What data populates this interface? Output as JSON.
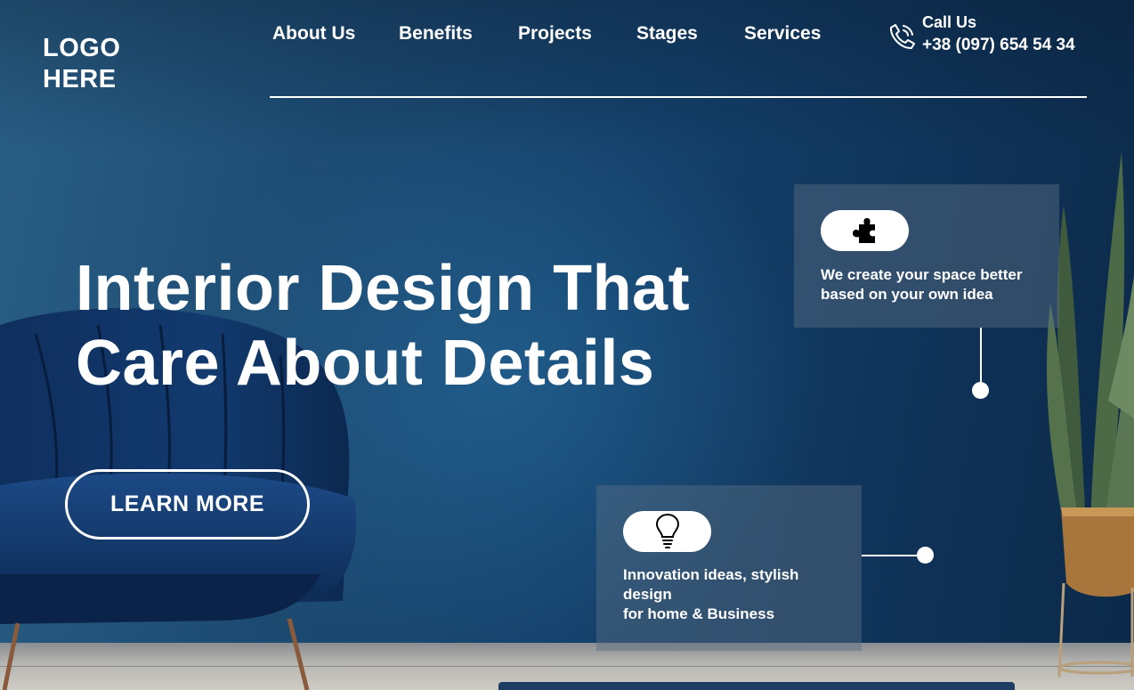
{
  "header": {
    "logo": "LOGO\nHERE",
    "nav": [
      {
        "label": "About Us"
      },
      {
        "label": "Benefits"
      },
      {
        "label": "Projects"
      },
      {
        "label": "Stages"
      },
      {
        "label": "Services"
      }
    ],
    "contact": {
      "label": "Call Us",
      "phone": "+38 (097) 654 54 34",
      "icon": "phone-icon"
    }
  },
  "hero": {
    "headline": "Interior Design That Care About Details",
    "cta_label": "LEARN MORE"
  },
  "features": [
    {
      "icon": "puzzle-piece-icon",
      "text": "We create your space better based on your own idea"
    },
    {
      "icon": "lightbulb-icon",
      "text": "Innovation ideas, stylish design\nfor home & Business"
    }
  ],
  "colors": {
    "background": "#14406a",
    "text": "#ffffff",
    "card": "#5c6e82"
  }
}
